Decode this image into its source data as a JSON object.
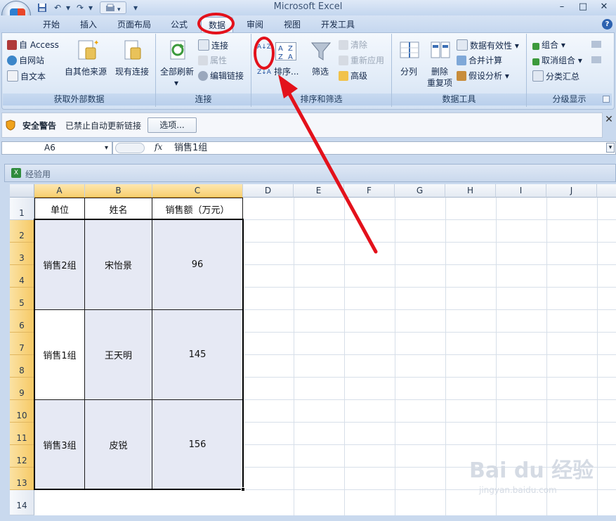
{
  "window": {
    "title": "Microsoft Excel",
    "minimize": "–",
    "restore": "□",
    "close": "✕"
  },
  "qat": {
    "undo": "↶",
    "redo": "↷",
    "dropdown": "▾"
  },
  "tabs": [
    {
      "label": "开始"
    },
    {
      "label": "插入"
    },
    {
      "label": "页面布局"
    },
    {
      "label": "公式"
    },
    {
      "label": "数据"
    },
    {
      "label": "审阅"
    },
    {
      "label": "视图"
    },
    {
      "label": "开发工具"
    }
  ],
  "help": "?",
  "ribbon": {
    "get_external": {
      "label": "获取外部数据",
      "access": "自 Access",
      "web": "自网站",
      "text": "自文本",
      "other": "自其他来源",
      "existing": "现有连接"
    },
    "connections": {
      "label": "连接",
      "refresh_all": "全部刷新",
      "connections": "连接",
      "properties": "属性",
      "edit_links": "编辑链接"
    },
    "sort_filter": {
      "label": "排序和筛选",
      "sort_asc": "A↓Z",
      "sort_desc": "Z↓A",
      "sort": "排序...",
      "filter": "筛选",
      "clear": "清除",
      "reapply": "重新应用",
      "advanced": "高级"
    },
    "data_tools": {
      "label": "数据工具",
      "text_to_columns": "分列",
      "remove_dup_1": "删除",
      "remove_dup_2": "重复项",
      "validation": "数据有效性",
      "consolidate": "合并计算",
      "what_if": "假设分析"
    },
    "outline": {
      "label": "分级显示",
      "group": "组合",
      "ungroup": "取消组合",
      "subtotal": "分类汇总"
    }
  },
  "security": {
    "title": "安全警告",
    "message": "已禁止自动更新链接",
    "options": "选项...",
    "close": "✕"
  },
  "formula_bar": {
    "name_box": "A6",
    "fx": "fx",
    "content": "销售1组"
  },
  "workbook": {
    "name": "经验用"
  },
  "columns": [
    "A",
    "B",
    "C",
    "D",
    "E",
    "F",
    "G",
    "H",
    "I",
    "J"
  ],
  "rows": [
    "1",
    "2",
    "3",
    "4",
    "5",
    "6",
    "7",
    "8",
    "9",
    "10",
    "11",
    "12",
    "13",
    "14"
  ],
  "header_row": [
    "单位",
    "姓名",
    "销售额（万元）"
  ],
  "records": [
    {
      "unit": "销售2组",
      "name": "宋怡景",
      "sales": "96"
    },
    {
      "unit": "销售1组",
      "name": "王天明",
      "sales": "145"
    },
    {
      "unit": "销售3组",
      "name": "皮锐",
      "sales": "156"
    }
  ],
  "watermark": {
    "main": "Bai du 经验",
    "sub": "jingyan.baidu.com"
  },
  "colors": {
    "annotation": "#e3111b",
    "selected_header": "#f8cf70",
    "data_fill": "#e6e9f4"
  }
}
